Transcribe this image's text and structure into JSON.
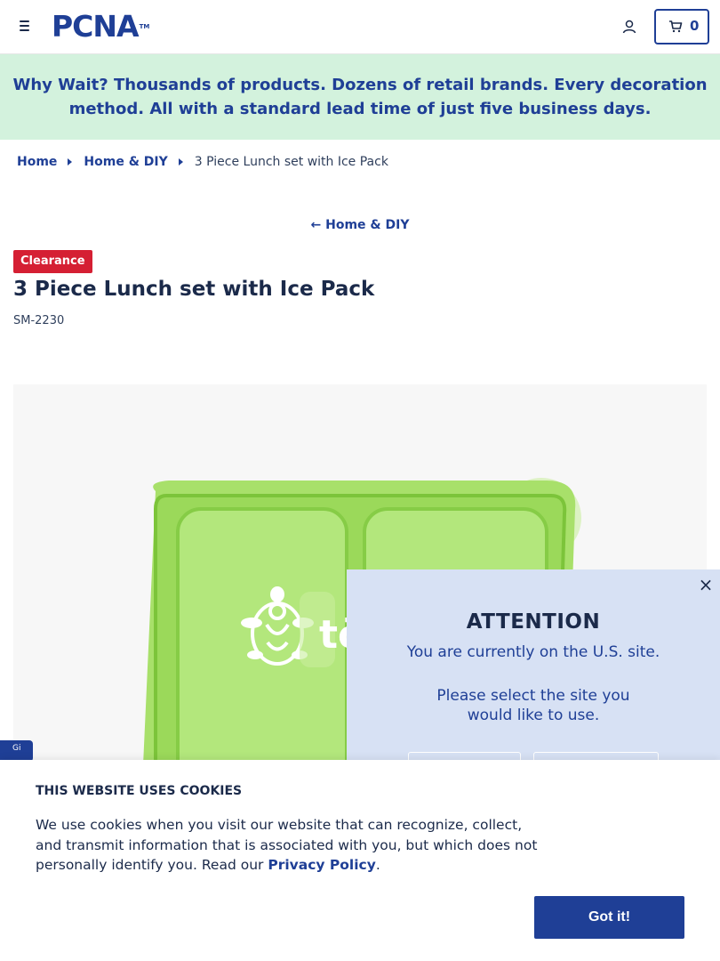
{
  "header": {
    "logo_text": "PCNA",
    "logo_tm": "TM",
    "cart_count": "0"
  },
  "promo": {
    "text": "Why Wait? Thousands of products. Dozens of retail brands. Every decoration method. All with a standard lead time of just five business days."
  },
  "breadcrumb": {
    "items": [
      {
        "label": "Home"
      },
      {
        "label": "Home & DIY"
      },
      {
        "label": "3 Piece Lunch set with Ice Pack"
      }
    ]
  },
  "back_link": {
    "arrow": "←",
    "label": "Home & DIY"
  },
  "product": {
    "badge": "Clearance",
    "title": "3 Piece Lunch set with Ice Pack",
    "sku": "SM-2230",
    "image_logo_text": "tö"
  },
  "feedback_tab": {
    "label": "Gi"
  },
  "attention_modal": {
    "close": "×",
    "title": "ATTENTION",
    "message": "You are currently on the U.S. site.",
    "prompt": "Please select the site you would like to use."
  },
  "cookie_banner": {
    "title": "THIS WEBSITE USES COOKIES",
    "text": "We use cookies when you visit our website that can recognize, collect, and transmit information that is associated with you, but which does not personally identify you. Read our ",
    "link": "Privacy Policy",
    "text_end": ".",
    "button": "Got it!"
  },
  "colors": {
    "brand_blue": "#1f3f96",
    "promo_bg": "#d3f2dd",
    "badge_red": "#d51f33",
    "modal_bg": "#d7e1f4",
    "product_green": "#9bd95a"
  }
}
